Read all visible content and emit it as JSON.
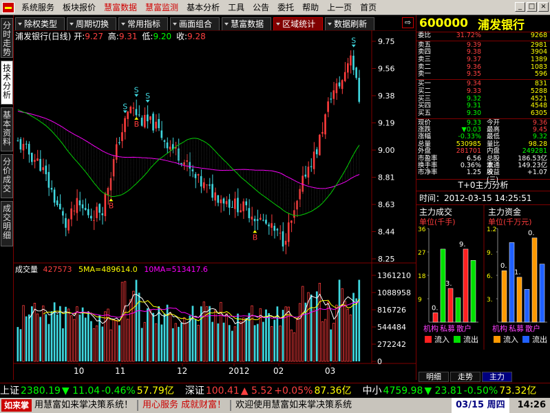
{
  "menu": [
    "系统服务",
    "板块报价",
    "慧富数据",
    "慧富监测",
    "基本分析",
    "工具",
    "公告",
    "委托",
    "帮助",
    "上一页",
    "首页"
  ],
  "menu_red": [
    2,
    3
  ],
  "window_buttons": [
    "_",
    "□",
    "×"
  ],
  "side_tabs": [
    {
      "label": "分时走势"
    },
    {
      "label": "技术分析",
      "active": true
    },
    {
      "label": "基本资料"
    },
    {
      "label": "分价成交"
    },
    {
      "label": "成交明细"
    }
  ],
  "toolbar": [
    {
      "label": "除权类型"
    },
    {
      "label": "周期切换"
    },
    {
      "label": "常用指标"
    },
    {
      "label": "画面组合"
    },
    {
      "label": "慧富数据"
    },
    {
      "label": "区域统计",
      "active": true
    },
    {
      "label": "数据刷新"
    }
  ],
  "toolbar_arrow": "⇨",
  "chart_title": {
    "name": "浦发银行(日线)",
    "open_label": "开:",
    "open": "9.27",
    "high_label": "高:",
    "high": "9.31",
    "low_label": "低:",
    "low": "9.20",
    "close_label": "收:",
    "close": "9.28"
  },
  "volume_title": {
    "label": "成交量",
    "value": "427573",
    "ma5": "5MA=489614.0",
    "ma10": "10MA=513417.6"
  },
  "chart_data": [
    {
      "type": "candlestick",
      "yticks": [
        "9.75",
        "9.56",
        "9.38",
        "9.19",
        "9.00",
        "8.81",
        "8.63",
        "8.44",
        "8.25"
      ],
      "ylim": [
        8.25,
        9.75
      ],
      "xticks": [
        "10",
        "11",
        "12",
        "2012",
        "02",
        "03"
      ],
      "markers": [
        "S",
        "S",
        "S",
        "B",
        "B",
        "S",
        "B"
      ]
    },
    {
      "type": "bar",
      "yticks": [
        "1361210",
        "1088958",
        "816726",
        "544484",
        "272242",
        "0"
      ],
      "ylim": [
        0,
        1361210
      ]
    }
  ],
  "stock": {
    "code": "600000",
    "name": "浦发银行"
  },
  "quote_head": {
    "label": "委比",
    "value": "31.72%",
    "volume": "9268"
  },
  "asks": [
    {
      "label": "卖五",
      "price": "9.39",
      "vol": "2981"
    },
    {
      "label": "卖四",
      "price": "9.38",
      "vol": "3904"
    },
    {
      "label": "卖三",
      "price": "9.37",
      "vol": "1389"
    },
    {
      "label": "卖二",
      "price": "9.36",
      "vol": "1083"
    },
    {
      "label": "卖一",
      "price": "9.35",
      "vol": "596"
    }
  ],
  "bids": [
    {
      "label": "买一",
      "price": "9.34",
      "vol": "831"
    },
    {
      "label": "买二",
      "price": "9.33",
      "vol": "5288"
    },
    {
      "label": "买三",
      "price": "9.32",
      "vol": "4521"
    },
    {
      "label": "买四",
      "price": "9.31",
      "vol": "4548"
    },
    {
      "label": "买五",
      "price": "9.30",
      "vol": "6305"
    }
  ],
  "stats": [
    {
      "l1": "现价",
      "v1": "9.33",
      "c1": "g",
      "l2": "今开",
      "v2": "9.36",
      "c2": "r"
    },
    {
      "l1": "涨跌",
      "v1": "▼0.03",
      "c1": "g",
      "l2": "最高",
      "v2": "9.45",
      "c2": "r"
    },
    {
      "l1": "涨幅",
      "v1": "-0.33%",
      "c1": "g",
      "l2": "最低",
      "v2": "9.32",
      "c2": "g"
    },
    {
      "l1": "总量",
      "v1": "530985",
      "c1": "y",
      "l2": "量比",
      "v2": "98.28",
      "c2": "y"
    },
    {
      "l1": "外盘",
      "v1": "281701",
      "c1": "r",
      "l2": "内盘",
      "v2": "249281",
      "c2": "g"
    },
    {
      "l1": "市盈率",
      "v1": "6.56",
      "c1": "w",
      "l2": "总股本",
      "v2": "186.53亿",
      "c2": "w"
    },
    {
      "l1": "换手率",
      "v1": "0.36%",
      "c1": "w",
      "l2": "流通股",
      "v2": "149.23亿",
      "c2": "w"
    },
    {
      "l1": "市净率",
      "v1": "1.25",
      "c1": "w",
      "l2": "收益(三)",
      "v2": "+1.07",
      "c2": "w"
    }
  ],
  "t0_title": "T+0主力分析",
  "time_label": "时间：",
  "time_value": "2012-03-15  14:25:51",
  "mini1": {
    "title": "主力成交",
    "unit": "单位(千手)",
    "yticks": [
      "36",
      "27",
      "18",
      "9"
    ],
    "cats": [
      "机构",
      "私募",
      "散户"
    ],
    "leg1": "流入",
    "leg2": "流出",
    "labels": [
      "0.",
      "3.",
      "9."
    ]
  },
  "mini2": {
    "title": "主力资金",
    "unit": "单位(千万元)",
    "yticks": [
      "1.2",
      "9.",
      "6.",
      "3."
    ],
    "cats": [
      "机构",
      "私募",
      "散户"
    ],
    "leg1": "流入",
    "leg2": "流出",
    "labels": [
      "0.",
      "1.",
      "0.",
      "6."
    ]
  },
  "bottom_tabs": [
    {
      "label": "明细"
    },
    {
      "label": "走势"
    },
    {
      "label": "主力",
      "active": true
    }
  ],
  "ticker1": [
    {
      "name": "上证",
      "val": "2380.19",
      "chg": "▼ 11.04",
      "pct": "-0.46%",
      "amt": "57.79亿",
      "c": "g"
    },
    {
      "name": "深证",
      "val": "100.41",
      "chg": "▲ 5.52",
      "pct": "+0.05%",
      "amt": "87.36亿",
      "c": "r"
    },
    {
      "name": "中小",
      "val": "4759.98",
      "chg": "▼ 23.81",
      "pct": "-0.50%",
      "amt": "73.32亿",
      "c": "g"
    }
  ],
  "ticker2": {
    "logo": "如来掌",
    "text1": "用慧富如来掌决策系统！",
    "text2": "用心服务  成就财富！",
    "text3": "欢迎使用慧富如来掌决策系统",
    "date": "03/15 周四",
    "time": "14:26"
  }
}
